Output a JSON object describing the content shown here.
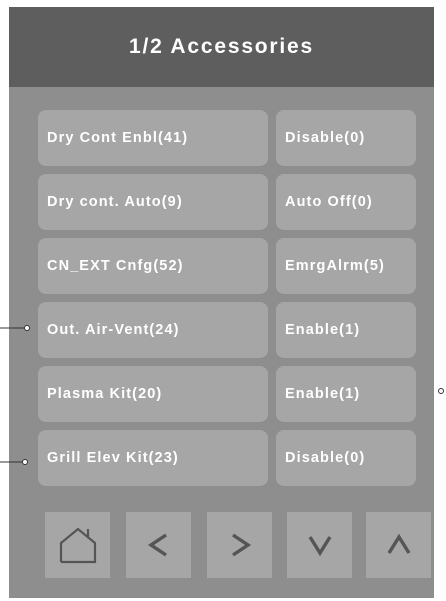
{
  "header": {
    "title": "1/2 Accessories"
  },
  "rows": [
    {
      "name": "Dry Cont Enbl(41)",
      "value": "Disable(0)"
    },
    {
      "name": "Dry cont. Auto(9)",
      "value": "Auto Off(0)"
    },
    {
      "name": "CN_EXT Cnfg(52)",
      "value": "EmrgAlrm(5)"
    },
    {
      "name": "Out. Air-Vent(24)",
      "value": "Enable(1)"
    },
    {
      "name": "Plasma Kit(20)",
      "value": "Enable(1)"
    },
    {
      "name": "Grill Elev Kit(23)",
      "value": "Disable(0)"
    }
  ],
  "nav": {
    "buttons": [
      {
        "icon": "home-icon"
      },
      {
        "icon": "chevron-left-icon"
      },
      {
        "icon": "chevron-right-icon"
      },
      {
        "icon": "chevron-down-icon"
      },
      {
        "icon": "chevron-up-icon"
      }
    ]
  },
  "colors": {
    "header_bg": "#5e5e5e",
    "panel_bg": "#8e8e8e",
    "button_bg": "#a6a6a6",
    "icon_color": "#555555",
    "text_color": "#ffffff"
  }
}
